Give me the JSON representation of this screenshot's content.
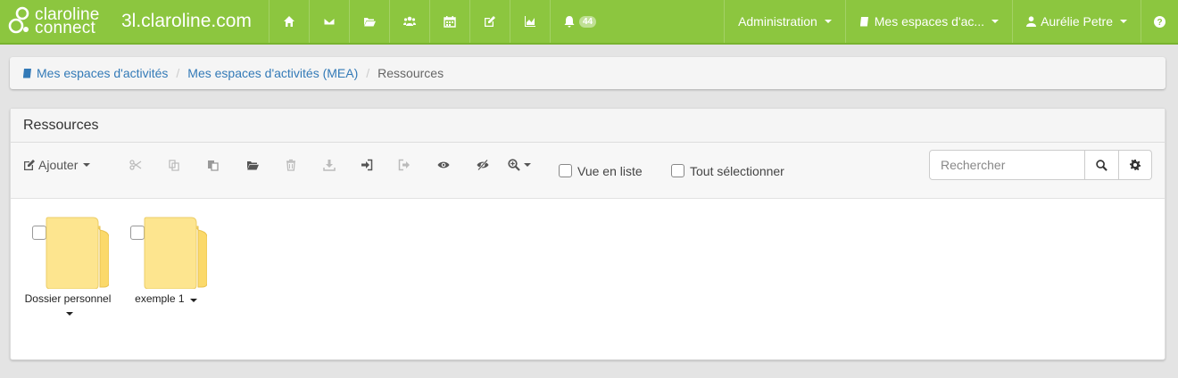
{
  "brand": {
    "line1": "claroline",
    "line2": "connect",
    "site": "3l.claroline.com"
  },
  "nav": {
    "icons": [
      "home-icon",
      "envelope-icon",
      "folder-open-icon",
      "users-icon",
      "calendar-icon",
      "edit-icon",
      "chart-area-icon"
    ],
    "notifications_count": "44",
    "administration": "Administration",
    "workspaces": "Mes espaces d'ac...",
    "user": "Aurélie Petre",
    "help": "?"
  },
  "breadcrumb": {
    "item1": "Mes espaces d'activités",
    "item2": "Mes espaces d'activités (MEA)",
    "current": "Ressources",
    "separator": "/"
  },
  "panel": {
    "title": "Ressources",
    "toolbar": {
      "add_label": "Ajouter",
      "list_view_label": "Vue en liste",
      "select_all_label": "Tout sélectionner",
      "search_placeholder": "Rechercher"
    },
    "resources": [
      {
        "name": "Dossier personnel",
        "type": "folder"
      },
      {
        "name": "exemple 1",
        "type": "folder"
      }
    ]
  },
  "colors": {
    "navbar": "#8cc63f",
    "link": "#337ab7",
    "folder": "#fde58f"
  }
}
